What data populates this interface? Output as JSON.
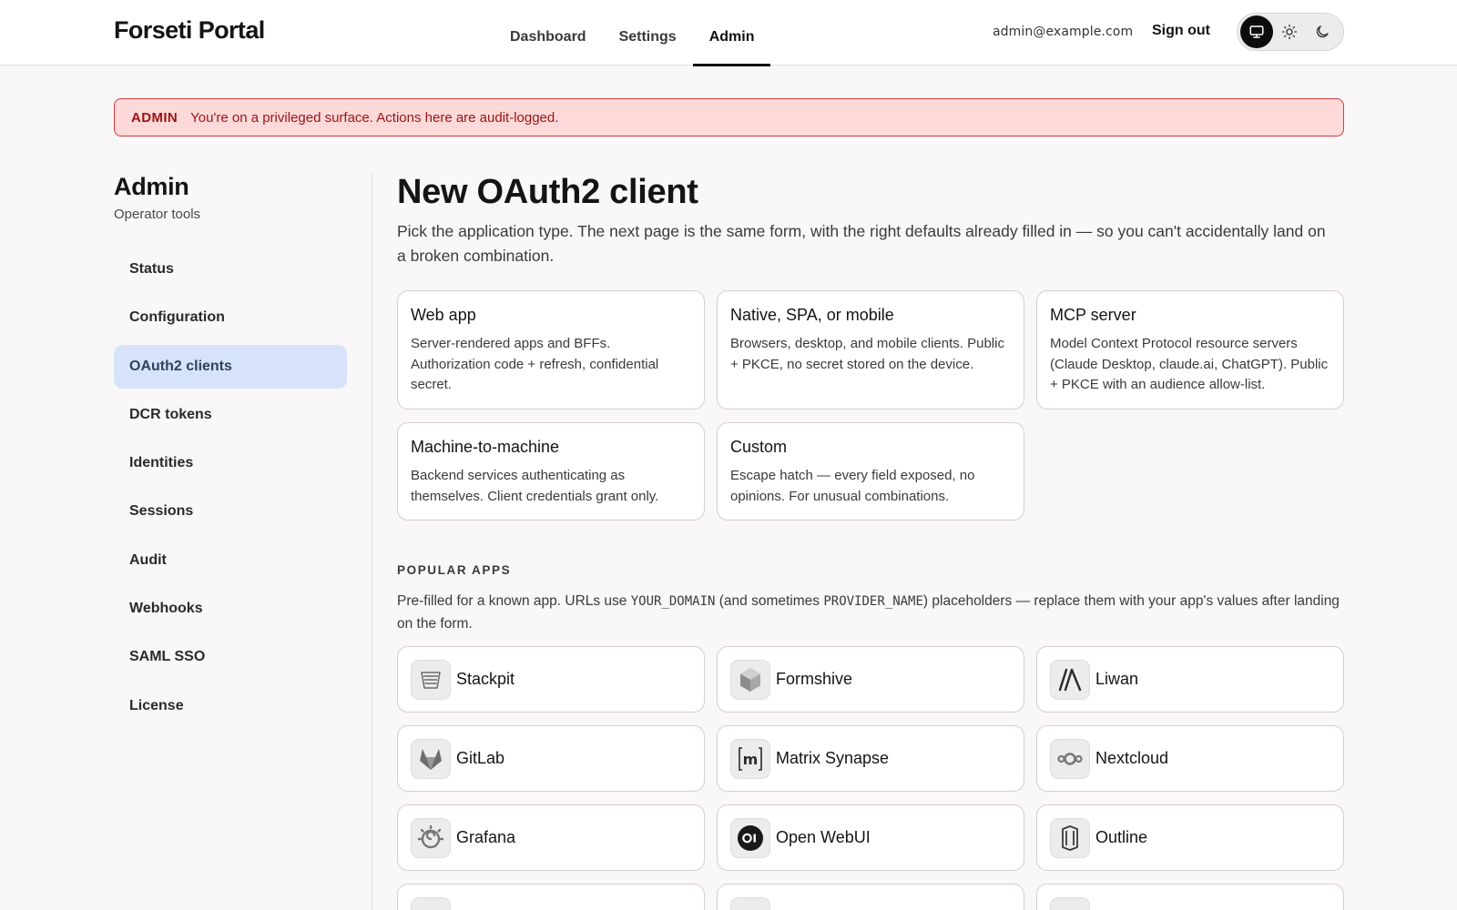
{
  "header": {
    "brand": "Forseti Portal",
    "nav": [
      {
        "label": "Dashboard"
      },
      {
        "label": "Settings"
      },
      {
        "label": "Admin"
      }
    ],
    "user_email": "admin@example.com",
    "signout_label": "Sign out",
    "theme_modes": [
      "system",
      "light",
      "dark"
    ],
    "active_theme": "system"
  },
  "banner": {
    "tag": "ADMIN",
    "text": "You're on a privileged surface. Actions here are audit-logged."
  },
  "sidebar": {
    "title": "Admin",
    "subtitle": "Operator tools",
    "items": [
      {
        "label": "Status"
      },
      {
        "label": "Configuration"
      },
      {
        "label": "OAuth2 clients"
      },
      {
        "label": "DCR tokens"
      },
      {
        "label": "Identities"
      },
      {
        "label": "Sessions"
      },
      {
        "label": "Audit"
      },
      {
        "label": "Webhooks"
      },
      {
        "label": "SAML SSO"
      },
      {
        "label": "License"
      }
    ],
    "active_item": "OAuth2 clients"
  },
  "main": {
    "title": "New OAuth2 client",
    "description": "Pick the application type. The next page is the same form, with the right defaults already filled in — so you can't accidentally land on a broken combination.",
    "types": [
      {
        "name": "Web app",
        "desc": "Server-rendered apps and BFFs. Authorization code + refresh, confidential secret."
      },
      {
        "name": "Native, SPA, or mobile",
        "desc": "Browsers, desktop, and mobile clients. Public + PKCE, no secret stored on the device."
      },
      {
        "name": "MCP server",
        "desc": "Model Context Protocol resource servers (Claude Desktop, claude.ai, ChatGPT). Public + PKCE with an audience allow-list."
      },
      {
        "name": "Machine-to-machine",
        "desc": "Backend services authenticating as themselves. Client credentials grant only."
      },
      {
        "name": "Custom",
        "desc": "Escape hatch — every field exposed, no opinions. For unusual combinations."
      }
    ],
    "popular": {
      "label": "POPULAR APPS",
      "desc_1": "Pre-filled for a known app. URLs use ",
      "code_1": "YOUR_DOMAIN",
      "desc_2": " (and sometimes ",
      "code_2": "PROVIDER_NAME",
      "desc_3": ") placeholders — replace them with your app's values after landing on the form.",
      "apps": [
        {
          "name": "Stackpit",
          "icon": "stackpit-icon"
        },
        {
          "name": "Formshive",
          "icon": "formshive-icon"
        },
        {
          "name": "Liwan",
          "icon": "liwan-icon"
        },
        {
          "name": "GitLab",
          "icon": "gitlab-icon"
        },
        {
          "name": "Matrix Synapse",
          "icon": "matrix-icon"
        },
        {
          "name": "Nextcloud",
          "icon": "nextcloud-icon"
        },
        {
          "name": "Grafana",
          "icon": "grafana-icon"
        },
        {
          "name": "Open WebUI",
          "icon": "openwebui-icon"
        },
        {
          "name": "Outline",
          "icon": "outline-icon"
        }
      ]
    }
  }
}
